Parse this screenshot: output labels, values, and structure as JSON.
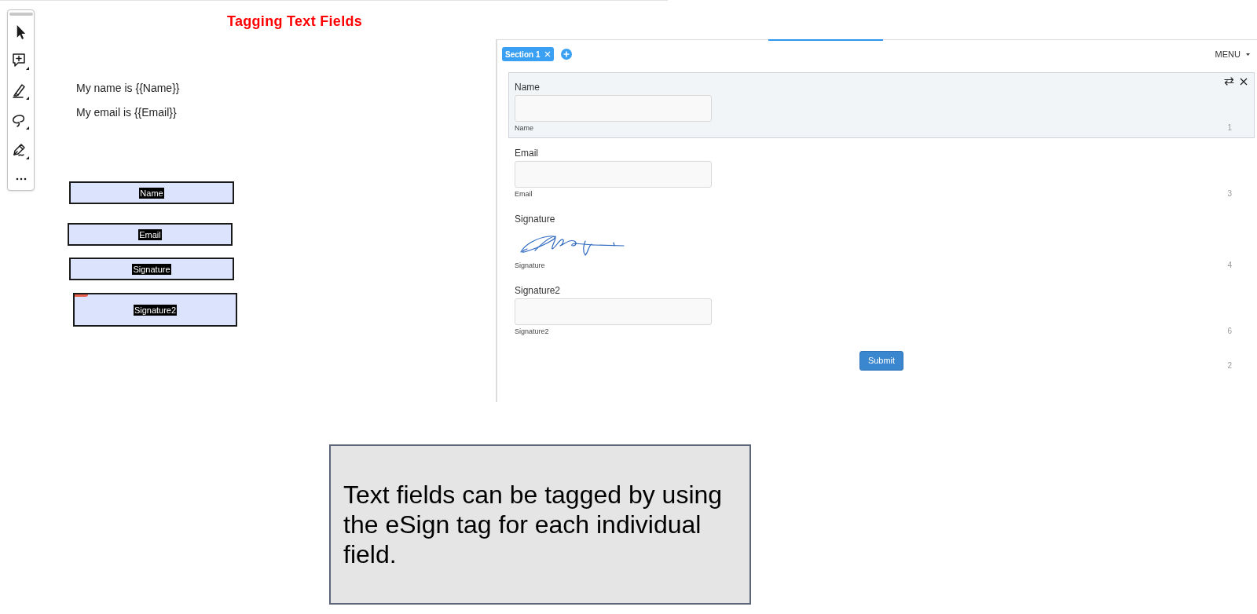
{
  "document": {
    "title": "Tagging Text Fields",
    "lines": [
      "My name is {{Name}}",
      "My email is {{Email}}"
    ],
    "tags": [
      {
        "label": "Name",
        "marked": false
      },
      {
        "label": "Email",
        "marked": false
      },
      {
        "label": "Signature",
        "marked": false
      },
      {
        "label": "Signature2",
        "marked": true
      }
    ]
  },
  "form": {
    "sections": [
      {
        "label": "Section 1",
        "selected": true
      }
    ],
    "menu": "MENU",
    "fields": [
      {
        "kind": "text",
        "label": "Name",
        "caption": "Name",
        "number": "1",
        "selected": true
      },
      {
        "kind": "text",
        "label": "Email",
        "caption": "Email",
        "number": "3",
        "selected": false
      },
      {
        "kind": "signature",
        "label": "Signature",
        "caption": "Signature",
        "number": "4",
        "selected": false
      },
      {
        "kind": "text",
        "label": "Signature2",
        "caption": "Signature2",
        "number": "6",
        "selected": false
      }
    ],
    "submit": {
      "label": "Submit",
      "number": "2"
    }
  },
  "callout": {
    "text": "Text fields can be tagged by using the eSign tag for each individual field."
  }
}
